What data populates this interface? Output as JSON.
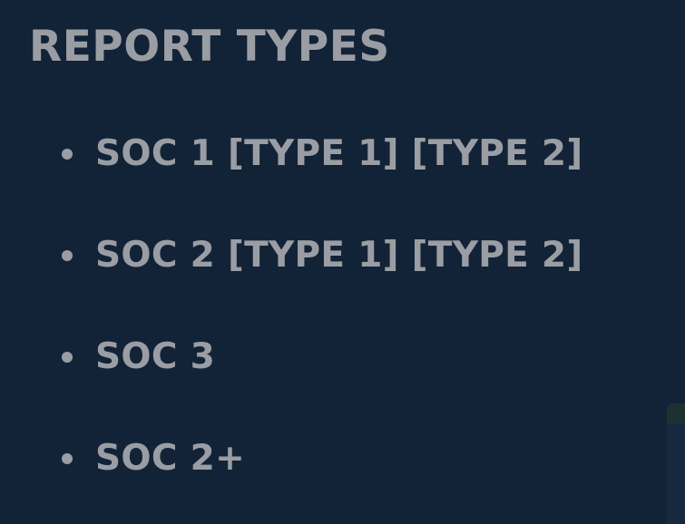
{
  "slide": {
    "title": "REPORT TYPES",
    "bullets": [
      {
        "text": "SOC 1 [TYPE 1] [TYPE 2]"
      },
      {
        "text": "SOC 2 [TYPE 1] [TYPE 2]"
      },
      {
        "text": "SOC 3"
      },
      {
        "text": "SOC 2+"
      }
    ]
  },
  "colors": {
    "background": "#132337",
    "text": "#9a9ea4"
  }
}
